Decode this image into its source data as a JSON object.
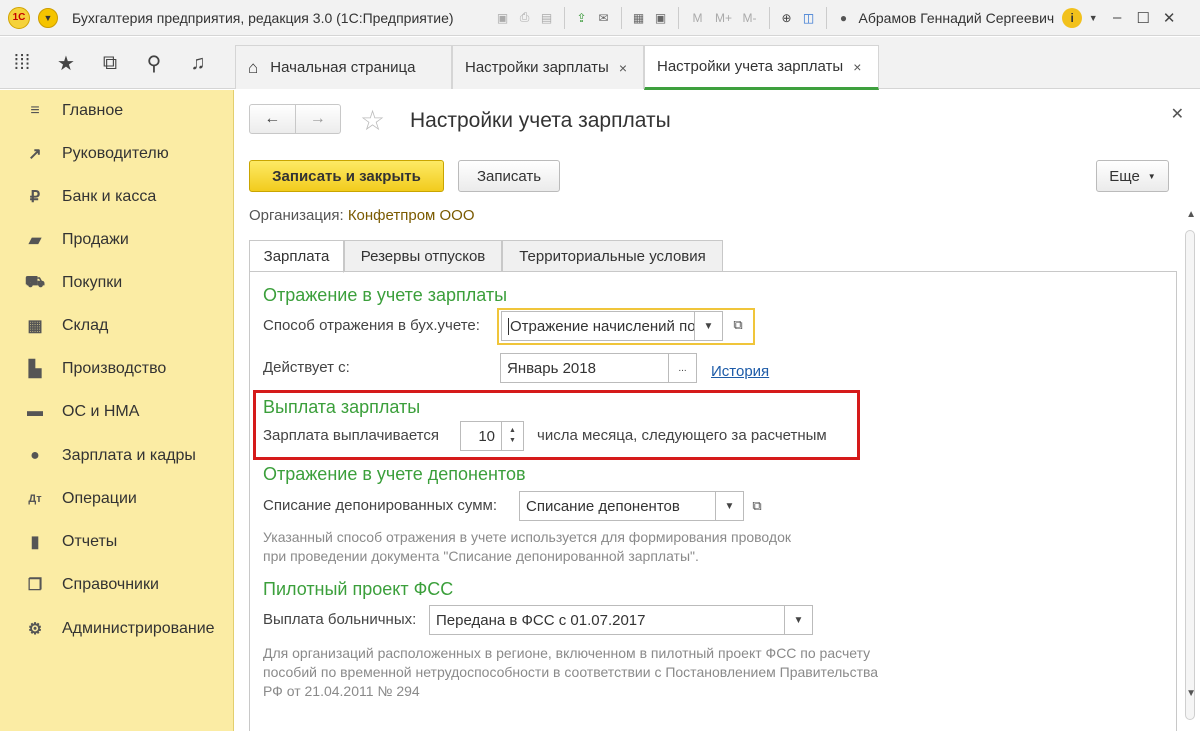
{
  "app": {
    "logo": "1С",
    "title": "Бухгалтерия предприятия, редакция 3.0  (1С:Предприятие)",
    "user": "Абрамов Геннадий Сергеевич",
    "toolbar_labels": {
      "m": "M",
      "mplus": "M+",
      "mminus": "M-"
    }
  },
  "tabs": [
    {
      "label": "Начальная страница",
      "icon": "home-icon"
    },
    {
      "label": "Настройки зарплаты",
      "close": "×"
    },
    {
      "label": "Настройки учета зарплаты",
      "close": "×",
      "active": true
    }
  ],
  "sidebar": {
    "items": [
      {
        "label": "Главное",
        "icon": "menu-lines-icon"
      },
      {
        "label": "Руководителю",
        "icon": "trend-chart-icon"
      },
      {
        "label": "Банк и касса",
        "icon": "ruble-coin-icon"
      },
      {
        "label": "Продажи",
        "icon": "shopping-bag-icon"
      },
      {
        "label": "Покупки",
        "icon": "cart-icon"
      },
      {
        "label": "Склад",
        "icon": "warehouse-icon"
      },
      {
        "label": "Производство",
        "icon": "factory-icon"
      },
      {
        "label": "ОС и НМА",
        "icon": "truck-icon"
      },
      {
        "label": "Зарплата и кадры",
        "icon": "person-icon"
      },
      {
        "label": "Операции",
        "icon": "operations-icon"
      },
      {
        "label": "Отчеты",
        "icon": "bar-chart-icon"
      },
      {
        "label": "Справочники",
        "icon": "books-icon"
      },
      {
        "label": "Администрирование",
        "icon": "gear-icon"
      }
    ]
  },
  "form": {
    "title": "Настройки учета зарплаты",
    "save_close": "Записать и закрыть",
    "save": "Записать",
    "more": "Еще",
    "org_label": "Организация:",
    "org_value": "Конфетпром ООО",
    "subtabs": [
      "Зарплата",
      "Резервы отпусков",
      "Территориальные условия"
    ]
  },
  "sections": {
    "reflection": {
      "title": "Отражение в учете зарплаты",
      "method_label": "Способ отражения в бух.учете:",
      "method_value": "Отражение начислений по",
      "valid_label": "Действует с:",
      "valid_value": "Январь 2018",
      "history_link": "История",
      "ellipsis": "..."
    },
    "payment": {
      "title": "Выплата зарплаты",
      "label": "Зарплата выплачивается",
      "day": "10",
      "suffix": "числа месяца, следующего за расчетным"
    },
    "deposits": {
      "title": "Отражение в учете депонентов",
      "label": "Списание депонированных сумм:",
      "value": "Списание депонентов",
      "hint1": "Указанный способ отражения в учете используется для формирования проводок",
      "hint2": "при проведении документа \"Списание депонированной зарплаты\"."
    },
    "fss": {
      "title": "Пилотный проект ФСС",
      "label": "Выплата больничных:",
      "value": "Передана в ФСС с 01.07.2017",
      "hint1": "Для организаций расположенных в регионе, включенном в пилотный проект ФСС по расчету",
      "hint2": "пособий по временной нетрудоспособности в соответствии с Постановлением Правительства",
      "hint3": "РФ от 21.04.2011 № 294"
    }
  },
  "colors": {
    "accent_green": "#3b9f3b",
    "sidebar_bg": "#fbeca4",
    "highlight_red": "#d51a1a",
    "primary_yellow": "#f2cc1d"
  }
}
